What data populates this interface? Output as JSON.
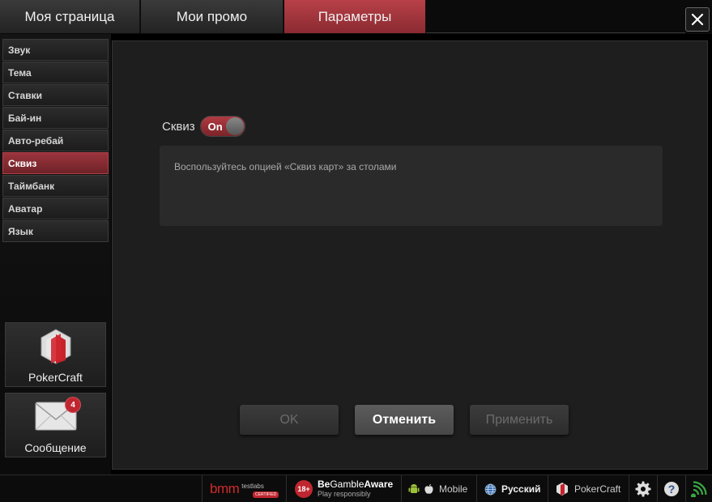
{
  "tabs": [
    {
      "label": "Моя страница",
      "active": false
    },
    {
      "label": "Мои промо",
      "active": false
    },
    {
      "label": "Параметры",
      "active": true
    }
  ],
  "close_icon": "close-icon",
  "sidebar": {
    "items": [
      {
        "label": "Звук",
        "active": false
      },
      {
        "label": "Тема",
        "active": false
      },
      {
        "label": "Ставки",
        "active": false
      },
      {
        "label": "Бай-ин",
        "active": false
      },
      {
        "label": "Авто-ребай",
        "active": false
      },
      {
        "label": "Сквиз",
        "active": true
      },
      {
        "label": "Таймбанк",
        "active": false
      },
      {
        "label": "Аватар",
        "active": false
      },
      {
        "label": "Язык",
        "active": false
      }
    ],
    "pokercraft_tile": {
      "label": "PokerCraft",
      "icon": "pokercraft-logo-icon"
    },
    "message_tile": {
      "label": "Сообщение",
      "icon": "envelope-icon",
      "badge": "4"
    }
  },
  "main": {
    "squeeze": {
      "label": "Сквиз",
      "toggle_text": "On",
      "enabled": true
    },
    "description": "Воспользуйтесь опцией «Сквиз карт» за столами",
    "buttons": {
      "ok": "OK",
      "cancel": "Отменить",
      "apply": "Применить"
    }
  },
  "bottom_bar": {
    "bmm": {
      "brand": "bmm",
      "sub": "testlabs",
      "stamp": "CERTIFIED"
    },
    "begambleaware": {
      "age": "18+",
      "title_be": "Be",
      "title_gamble": "Gamble",
      "title_aware": "Aware",
      "subtitle": "Play responsibly"
    },
    "mobile": "Mobile",
    "language": "Русский",
    "pokercraft": "PokerCraft"
  },
  "colors": {
    "accent": "#a8343c",
    "background": "#1e1e1e",
    "panel": "#2a2a2a"
  }
}
